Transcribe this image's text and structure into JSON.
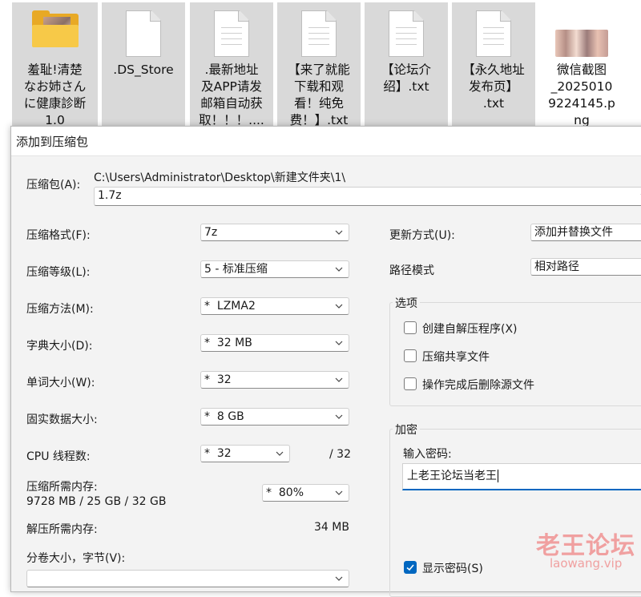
{
  "desktop": {
    "files": [
      {
        "name": "羞耻!清楚\nなお姉さん\nに健康診断\n1.0",
        "icon": "folder-with-image-icon",
        "selected": true
      },
      {
        "name": ".DS_Store",
        "icon": "blank-file-icon",
        "selected": true
      },
      {
        "name": ".最新地址\n及APP请发\n邮箱自动获\n取！！！....",
        "icon": "text-file-icon",
        "selected": true
      },
      {
        "name": "【来了就能\n下载和观\n看！纯免\n费！】.txt",
        "icon": "text-file-icon",
        "selected": true
      },
      {
        "name": "【论坛介\n绍】.txt",
        "icon": "text-file-icon",
        "selected": true
      },
      {
        "name": "【永久地址\n发布页】\n.txt",
        "icon": "text-file-icon",
        "selected": true
      },
      {
        "name": "微信截图\n_2025010\n9224145.p\nng",
        "icon": "image-thumbnail-icon",
        "selected": false
      }
    ]
  },
  "dialog": {
    "title": "添加到压缩包",
    "archive_label": "压缩包(A):",
    "archive_path": "C:\\Users\\Administrator\\Desktop\\新建文件夹\\1\\",
    "archive_name": "1.7z",
    "format_label": "压缩格式(F):",
    "format_value": "7z",
    "level_label": "压缩等级(L):",
    "level_value": "5 - 标准压缩",
    "method_label": "压缩方法(M):",
    "method_value": "*  LZMA2",
    "dict_label": "字典大小(D):",
    "dict_value": "*  32 MB",
    "word_label": "单词大小(W):",
    "word_value": "*  32",
    "solid_label": "固实数据大小:",
    "solid_value": "*  8 GB",
    "cpu_label": "CPU 线程数:",
    "cpu_value": "*  32",
    "cpu_total": "/ 32",
    "mem_comp_label": "压缩所需内存:",
    "mem_comp_value": "9728 MB / 25 GB / 32 GB",
    "mem_percent": "*  80%",
    "mem_decomp_label": "解压所需内存:",
    "mem_decomp_value": "34 MB",
    "volume_label": "分卷大小，字节(V):",
    "volume_value": "",
    "update_label": "更新方式(U):",
    "update_value": "添加并替换文件",
    "path_label": "路径模式",
    "path_value": "相对路径",
    "options": {
      "title": "选项",
      "items": [
        {
          "label": "创建自解压程序(X)",
          "checked": false
        },
        {
          "label": "压缩共享文件",
          "checked": false
        },
        {
          "label": "操作完成后删除源文件",
          "checked": false
        }
      ]
    },
    "encryption": {
      "title": "加密",
      "password_label": "输入密码:",
      "password_value": "上老王论坛当老王",
      "show_password_label": "显示密码(S)",
      "show_password_checked": true
    }
  },
  "watermark": {
    "main": "老王论坛",
    "sub": "laowang.vip"
  },
  "colors": {
    "accent": "#0067c0",
    "selection": "#d9d9d9",
    "watermark": "#f0a0a0"
  }
}
